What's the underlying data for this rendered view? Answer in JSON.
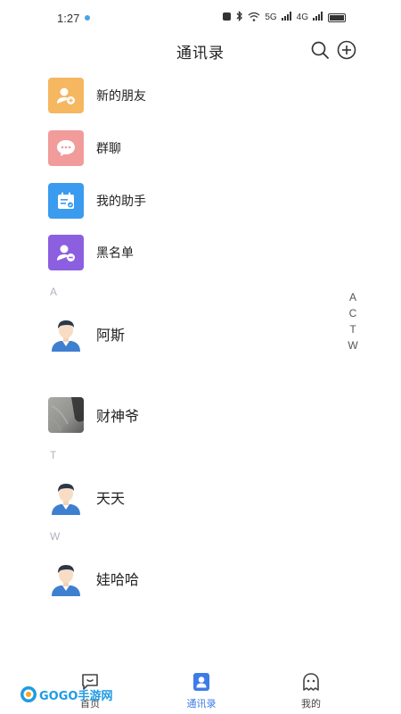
{
  "status_bar": {
    "time": "1:27",
    "network": "5G",
    "network2": "4G"
  },
  "header": {
    "title": "通讯录"
  },
  "functions": [
    {
      "label": "新的朋友",
      "icon": "add-friend-icon",
      "color": "#f5b760"
    },
    {
      "label": "群聊",
      "icon": "chat-bubble-icon",
      "color": "#f29b9b"
    },
    {
      "label": "我的助手",
      "icon": "calendar-icon",
      "color": "#3a9bef"
    },
    {
      "label": "黑名单",
      "icon": "block-user-icon",
      "color": "#8b5fe0"
    }
  ],
  "sections": [
    {
      "letter": "A",
      "contacts": [
        {
          "name": "阿斯",
          "avatar": "cartoon-man"
        },
        {
          "name": "财神爷",
          "avatar": "gray-photo"
        }
      ]
    },
    {
      "letter": "T",
      "contacts": [
        {
          "name": "天天",
          "avatar": "cartoon-man"
        }
      ]
    },
    {
      "letter": "W",
      "contacts": [
        {
          "name": "娃哈哈",
          "avatar": "cartoon-man"
        }
      ]
    }
  ],
  "index_letters": [
    "A",
    "C",
    "T",
    "W"
  ],
  "tabs": [
    {
      "label": "首页",
      "icon": "home-chat-icon",
      "active": false
    },
    {
      "label": "通讯录",
      "icon": "contacts-icon",
      "active": true
    },
    {
      "label": "我的",
      "icon": "profile-icon",
      "active": false
    }
  ],
  "watermark": {
    "text": "GOGO手游网"
  },
  "colors": {
    "accent": "#3d7be6",
    "section_letter": "#b0b4c0"
  }
}
